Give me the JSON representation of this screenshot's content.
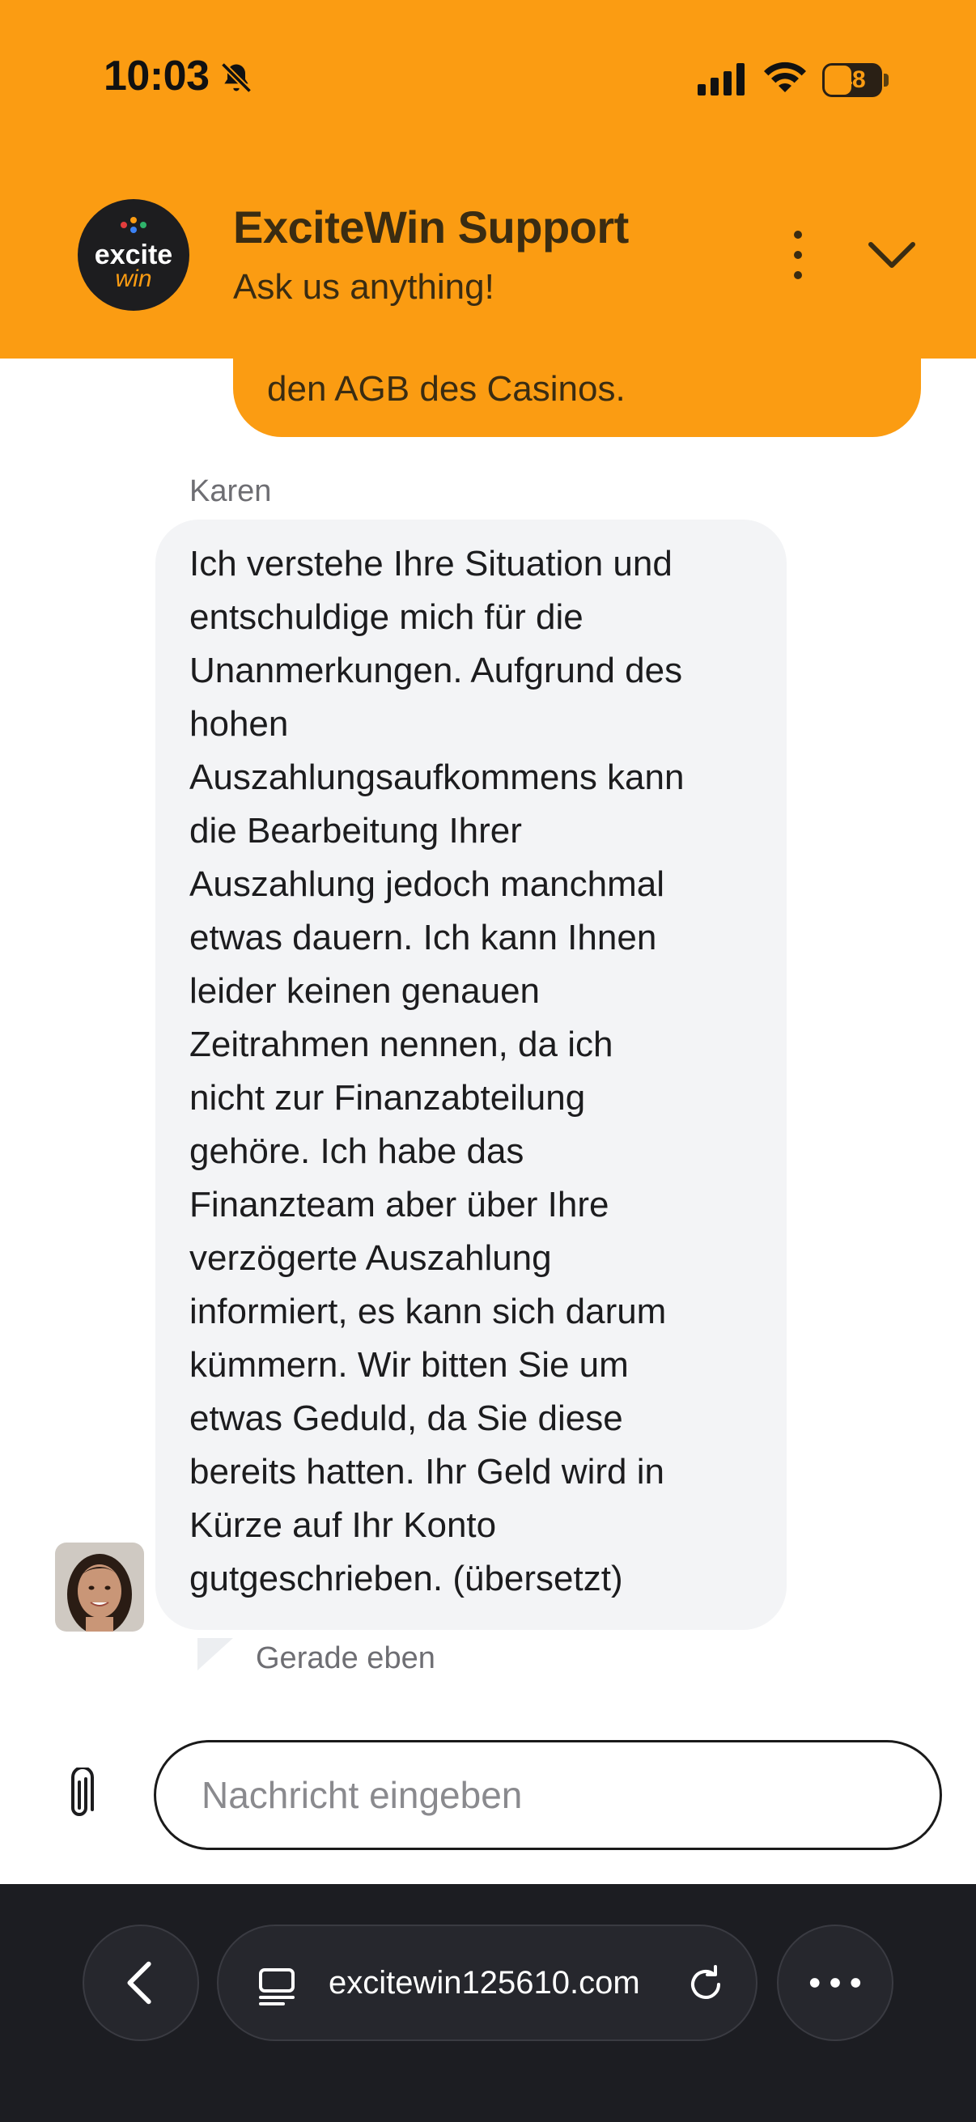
{
  "status_bar": {
    "time": "10:03",
    "battery_level": "48",
    "icons": [
      "bell-slash-icon",
      "signal-icon",
      "wifi-icon",
      "battery-icon"
    ]
  },
  "header": {
    "logo": {
      "word": "excite",
      "sub": "win"
    },
    "title": "ExciteWin Support",
    "subtitle": "Ask us anything!",
    "icons": [
      "more-vertical-icon",
      "chevron-down-icon"
    ],
    "accent_color": "#fb9c12"
  },
  "chat": {
    "previous_message_tail": "den AGB des Casinos.",
    "agent_name": "Karen",
    "message_lines": [
      "Ich verstehe Ihre Situation und",
      "entschuldige mich für die",
      "Unanmerkungen. Aufgrund des",
      "hohen",
      "Auszahlungsaufkommens kann",
      "die Bearbeitung Ihrer",
      "Auszahlung jedoch manchmal",
      "etwas dauern. Ich kann Ihnen",
      "leider keinen genauen",
      "Zeitrahmen nennen, da ich",
      "nicht zur Finanzabteilung",
      "gehöre. Ich habe das",
      "Finanzteam aber über Ihre",
      "verzögerte Auszahlung",
      "informiert, es kann sich darum",
      "kümmern. Wir bitten Sie um",
      "etwas Geduld, da Sie diese",
      "bereits hatten. Ihr Geld wird in",
      "Kürze auf Ihr Konto",
      "gutgeschrieben. (übersetzt)"
    ],
    "timestamp": "Gerade eben"
  },
  "composer": {
    "placeholder": "Nachricht eingeben",
    "value": "",
    "attach_icon": "paperclip-icon"
  },
  "browser": {
    "url": "excitewin125610.com",
    "icons": [
      "back-icon",
      "tab-icon",
      "reload-icon",
      "more-horizontal-icon"
    ]
  }
}
